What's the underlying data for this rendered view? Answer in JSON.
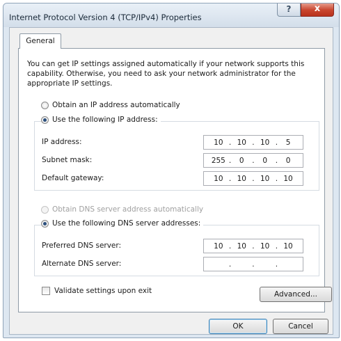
{
  "window": {
    "title": "Internet Protocol Version 4 (TCP/IPv4) Properties",
    "help_label": "?",
    "close_label": "x"
  },
  "tabs": [
    {
      "label": "General",
      "selected": true
    }
  ],
  "description": "You can get IP settings assigned automatically if your network supports this capability. Otherwise, you need to ask your network administrator for the appropriate IP settings.",
  "ip_section": {
    "obtain_auto_label": "Obtain an IP address automatically",
    "use_following_label": "Use the following IP address:",
    "selected": "use_following",
    "fields": [
      {
        "label": "IP address:",
        "octets": [
          "10",
          "10",
          "10",
          "5"
        ]
      },
      {
        "label": "Subnet mask:",
        "octets": [
          "255",
          "0",
          "0",
          "0"
        ]
      },
      {
        "label": "Default gateway:",
        "octets": [
          "10",
          "10",
          "10",
          "10"
        ]
      }
    ]
  },
  "dns_section": {
    "obtain_auto_label": "Obtain DNS server address automatically",
    "obtain_auto_enabled": false,
    "use_following_label": "Use the following DNS server addresses:",
    "selected": "use_following",
    "fields": [
      {
        "label": "Preferred DNS server:",
        "octets": [
          "10",
          "10",
          "10",
          "10"
        ]
      },
      {
        "label": "Alternate DNS server:",
        "octets": [
          "",
          "",
          "",
          ""
        ]
      }
    ]
  },
  "validate_label": "Validate settings upon exit",
  "validate_checked": false,
  "buttons": {
    "advanced": "Advanced...",
    "ok": "OK",
    "cancel": "Cancel"
  },
  "colors": {
    "title_bar": "#dde7f1",
    "close_button": "#c9462f",
    "radio_dot": "#2b4f7d",
    "disabled_text": "#a0a0a0"
  }
}
